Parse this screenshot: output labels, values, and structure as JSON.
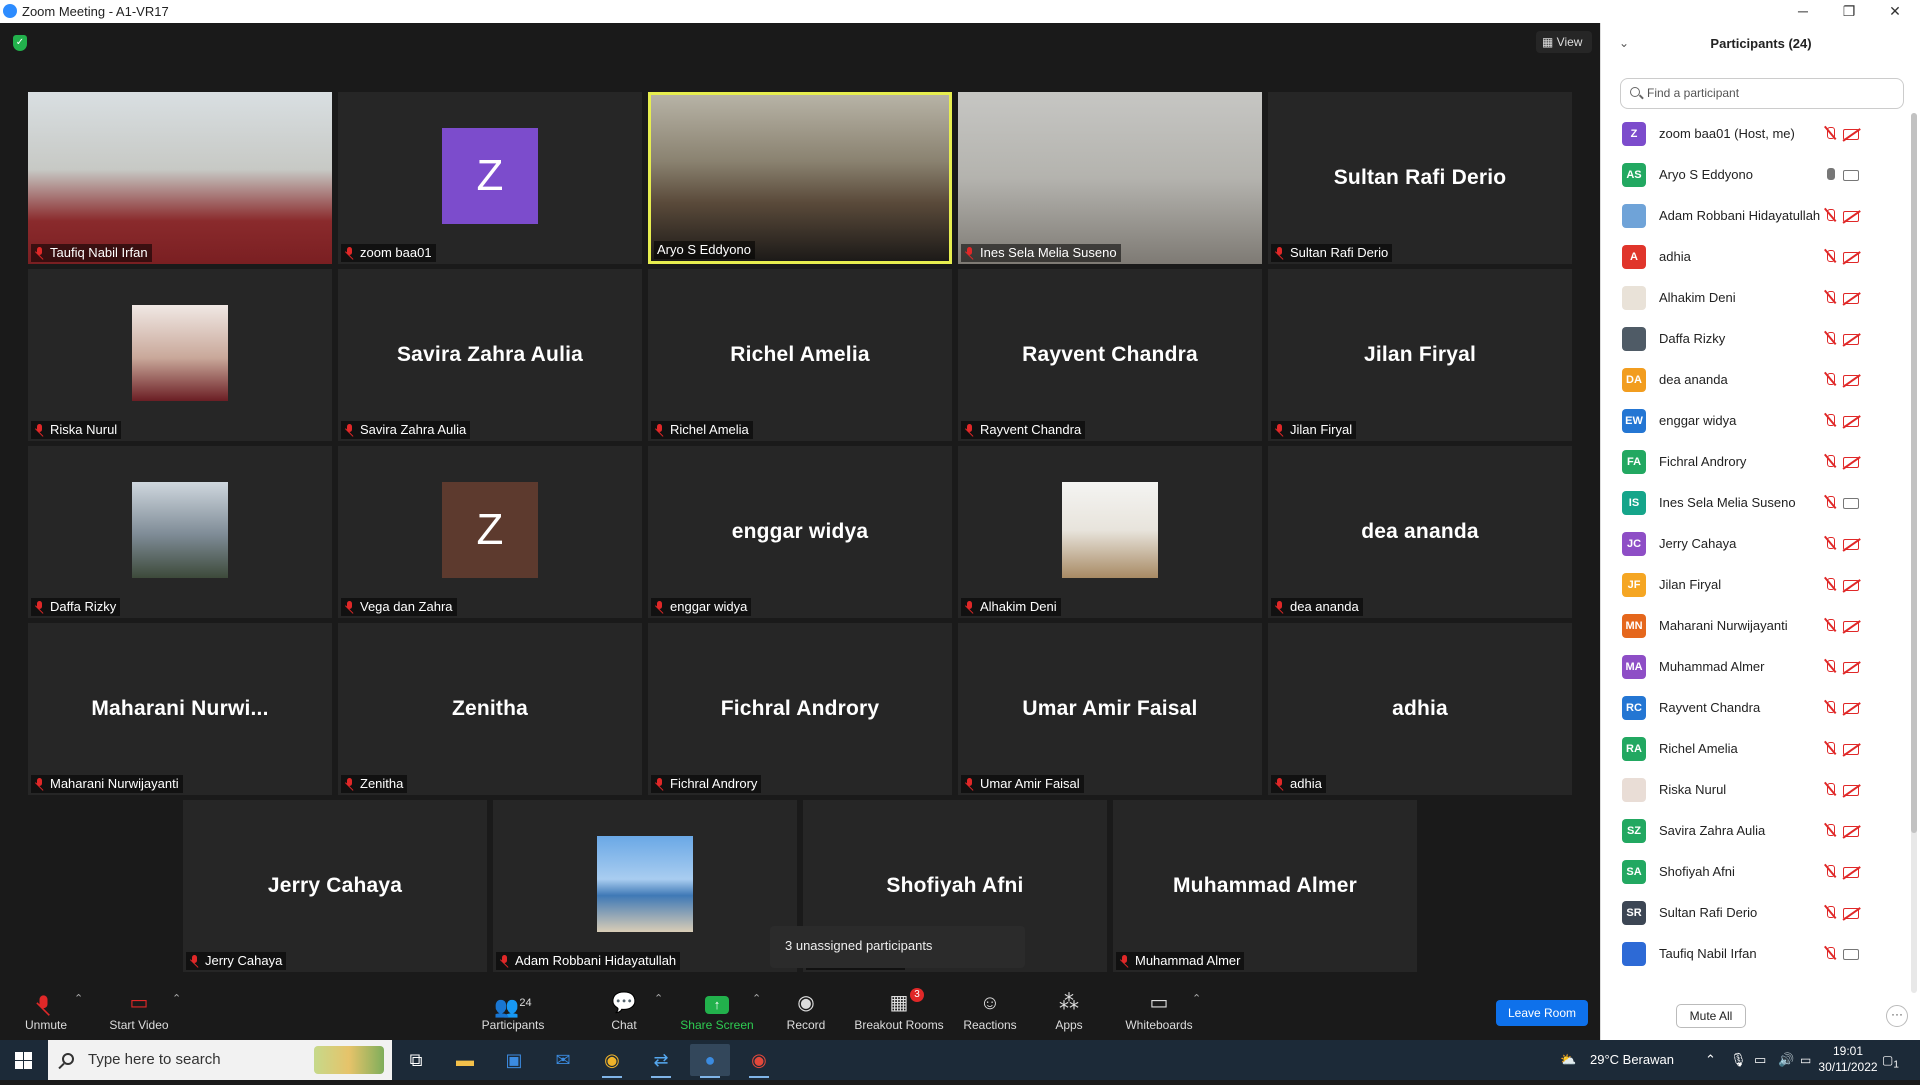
{
  "window": {
    "title": "Zoom Meeting - A1-VR17",
    "minimize": "─",
    "maximize": "❐",
    "close": "✕"
  },
  "header": {
    "view_label": "View",
    "view_icon": "grid-icon",
    "secure_icon": "shield-check-icon"
  },
  "tiles": [
    {
      "name": "Taufiq Nabil Irfan",
      "display": "",
      "kind": "video"
    },
    {
      "name": "zoom baa01",
      "display": "Z",
      "kind": "letter",
      "color": "#7c4ccc"
    },
    {
      "name": "Aryo S Eddyono",
      "display": "",
      "kind": "video",
      "active": true
    },
    {
      "name": "Ines Sela Melia Suseno",
      "display": "",
      "kind": "video"
    },
    {
      "name": "Sultan Rafi Derio",
      "display": "Sultan Rafi Derio",
      "kind": "text"
    },
    {
      "name": "Riska Nurul",
      "display": "",
      "kind": "photo"
    },
    {
      "name": "Savira Zahra Aulia",
      "display": "Savira Zahra Aulia",
      "kind": "text"
    },
    {
      "name": "Richel Amelia",
      "display": "Richel Amelia",
      "kind": "text"
    },
    {
      "name": "Rayvent Chandra",
      "display": "Rayvent Chandra",
      "kind": "text"
    },
    {
      "name": "Jilan Firyal",
      "display": "Jilan Firyal",
      "kind": "text"
    },
    {
      "name": "Daffa Rizky",
      "display": "",
      "kind": "photo"
    },
    {
      "name": "Vega dan Zahra",
      "display": "Z",
      "kind": "letter",
      "color": "#5d3a2e"
    },
    {
      "name": "enggar widya",
      "display": "enggar widya",
      "kind": "text"
    },
    {
      "name": "Alhakim Deni",
      "display": "",
      "kind": "photo"
    },
    {
      "name": "dea ananda",
      "display": "dea ananda",
      "kind": "text"
    },
    {
      "name": "Maharani Nurwijayanti",
      "display": "Maharani  Nurwi...",
      "kind": "text"
    },
    {
      "name": "Zenitha",
      "display": "Zenitha",
      "kind": "text"
    },
    {
      "name": "Fichral Androry",
      "display": "Fichral Androry",
      "kind": "text"
    },
    {
      "name": "Umar Amir Faisal",
      "display": "Umar Amir Faisal",
      "kind": "text"
    },
    {
      "name": "adhia",
      "display": "adhia",
      "kind": "text"
    },
    {
      "name": "Jerry Cahaya",
      "display": "Jerry Cahaya",
      "kind": "text"
    },
    {
      "name": "Adam Robbani Hidayatullah",
      "display": "",
      "kind": "photo"
    },
    {
      "name": "Shofiyah Afni",
      "display": "Shofiyah Afni",
      "kind": "text"
    },
    {
      "name": "Muhammad Almer",
      "display": "Muhammad Almer",
      "kind": "text"
    }
  ],
  "popup": {
    "text": "3 unassigned participants"
  },
  "toolbar": {
    "unmute": "Unmute",
    "start_video": "Start Video",
    "participants": "Participants",
    "participants_count": "24",
    "chat": "Chat",
    "share_screen": "Share Screen",
    "record": "Record",
    "breakout": "Breakout Rooms",
    "breakout_badge": "3",
    "reactions": "Reactions",
    "apps": "Apps",
    "whiteboards": "Whiteboards",
    "leave": "Leave Room"
  },
  "panel": {
    "title": "Participants (24)",
    "search_placeholder": "Find a participant",
    "mute_all": "Mute All",
    "more": "···",
    "participants": [
      {
        "initials": "Z",
        "name": "zoom baa01 (Host, me)",
        "color": "#7c4ccc",
        "mic": "off",
        "cam": "off"
      },
      {
        "initials": "AS",
        "name": "Aryo S Eddyono",
        "color": "#22a861",
        "mic": "on",
        "cam": "on"
      },
      {
        "initials": "",
        "name": "Adam Robbani Hidayatullah",
        "color": "#6fa3d8",
        "mic": "off",
        "cam": "off"
      },
      {
        "initials": "A",
        "name": "adhia",
        "color": "#e0352b",
        "mic": "off",
        "cam": "off"
      },
      {
        "initials": "",
        "name": "Alhakim Deni",
        "color": "#e9e2d8",
        "mic": "off",
        "cam": "off"
      },
      {
        "initials": "",
        "name": "Daffa Rizky",
        "color": "#4f5b66",
        "mic": "off",
        "cam": "off"
      },
      {
        "initials": "DA",
        "name": "dea ananda",
        "color": "#f29d1f",
        "mic": "off",
        "cam": "off"
      },
      {
        "initials": "EW",
        "name": "enggar widya",
        "color": "#2476d3",
        "mic": "off",
        "cam": "off"
      },
      {
        "initials": "FA",
        "name": "Fichral Androry",
        "color": "#22a861",
        "mic": "off",
        "cam": "off"
      },
      {
        "initials": "IS",
        "name": "Ines Sela Melia Suseno",
        "color": "#15a58a",
        "mic": "off",
        "cam": "on"
      },
      {
        "initials": "JC",
        "name": "Jerry Cahaya",
        "color": "#8e4ec6",
        "mic": "off",
        "cam": "off"
      },
      {
        "initials": "JF",
        "name": "Jilan Firyal",
        "color": "#f5a623",
        "mic": "off",
        "cam": "off"
      },
      {
        "initials": "MN",
        "name": "Maharani Nurwijayanti",
        "color": "#e5671c",
        "mic": "off",
        "cam": "off"
      },
      {
        "initials": "MA",
        "name": "Muhammad Almer",
        "color": "#8e4ec6",
        "mic": "off",
        "cam": "off"
      },
      {
        "initials": "RC",
        "name": "Rayvent Chandra",
        "color": "#2476d3",
        "mic": "off",
        "cam": "off"
      },
      {
        "initials": "RA",
        "name": "Richel Amelia",
        "color": "#22a861",
        "mic": "off",
        "cam": "off"
      },
      {
        "initials": "",
        "name": "Riska Nurul",
        "color": "#e9ddd6",
        "mic": "off",
        "cam": "off"
      },
      {
        "initials": "SZ",
        "name": "Savira Zahra Aulia",
        "color": "#22a861",
        "mic": "off",
        "cam": "off"
      },
      {
        "initials": "SA",
        "name": "Shofiyah Afni",
        "color": "#22a861",
        "mic": "off",
        "cam": "off"
      },
      {
        "initials": "SR",
        "name": "Sultan Rafi Derio",
        "color": "#3c4654",
        "mic": "off",
        "cam": "off"
      },
      {
        "initials": "",
        "name": "Taufiq Nabil Irfan",
        "color": "#2d6ad6",
        "mic": "off",
        "cam": "on"
      }
    ]
  },
  "taskbar": {
    "search_placeholder": "Type here to search",
    "weather": "29°C  Berawan",
    "time": "19:01",
    "date": "30/11/2022",
    "notifications": "1"
  }
}
